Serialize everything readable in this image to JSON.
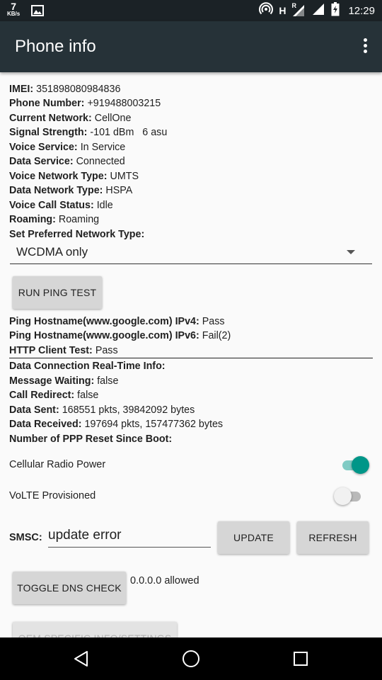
{
  "status_bar": {
    "net_speed_value": "7",
    "net_speed_unit": "KB/s",
    "network_letter": "H",
    "roaming_letter": "R",
    "time": "12:29"
  },
  "app_bar": {
    "title": "Phone info",
    "overflow_icon": "more-vert-icon"
  },
  "info": [
    {
      "label": "IMEI:",
      "value": "351898080984836"
    },
    {
      "label": "Phone Number:",
      "value": "+919488003215"
    },
    {
      "label": "Current Network:",
      "value": "CellOne"
    },
    {
      "label": "Signal Strength:",
      "value": "-101 dBm   6 asu"
    },
    {
      "label": "Voice Service:",
      "value": "In Service"
    },
    {
      "label": "Data Service:",
      "value": "Connected"
    },
    {
      "label": "Voice Network Type:",
      "value": "UMTS"
    },
    {
      "label": "Data Network Type:",
      "value": "HSPA"
    },
    {
      "label": "Voice Call Status:",
      "value": "Idle"
    },
    {
      "label": "Roaming:",
      "value": "Roaming"
    },
    {
      "label": "Set Preferred Network Type:",
      "value": ""
    }
  ],
  "preferred_network": {
    "selected": "WCDMA only"
  },
  "ping_button": "RUN PING TEST",
  "ping_results": [
    {
      "label": "Ping Hostname(www.google.com) IPv4:",
      "value": "Pass"
    },
    {
      "label": "Ping Hostname(www.google.com) IPv6:",
      "value": "Fail(2)"
    },
    {
      "label": "HTTP Client Test:",
      "value": "Pass"
    }
  ],
  "data_info": [
    {
      "label": "Data Connection Real-Time Info:",
      "value": ""
    },
    {
      "label": "Message Waiting:",
      "value": "false"
    },
    {
      "label": "Call Redirect:",
      "value": "false"
    },
    {
      "label": "Data Sent:",
      "value": "168551 pkts, 39842092 bytes"
    },
    {
      "label": "Data Received:",
      "value": "197694 pkts, 157477362 bytes"
    },
    {
      "label": "Number of PPP Reset Since Boot:",
      "value": ""
    }
  ],
  "toggles": {
    "cellular_radio_power": {
      "label": "Cellular Radio Power",
      "on": true
    },
    "volte_provisioned": {
      "label": "VoLTE Provisioned",
      "on": false
    }
  },
  "smsc": {
    "label": "SMSC:",
    "value": "update error",
    "update_button": "UPDATE",
    "refresh_button": "REFRESH"
  },
  "dns": {
    "button": "TOGGLE DNS CHECK",
    "status": "0.0.0.0 allowed"
  },
  "oem_button": "OEM SPECIFIC INFO/SETTINGS",
  "colors": {
    "status_bar_bg": "#1b2226",
    "app_bar_bg": "#263238",
    "accent": "#009688",
    "accent_track": "#80cbc4",
    "page_bg": "#fafafa"
  }
}
